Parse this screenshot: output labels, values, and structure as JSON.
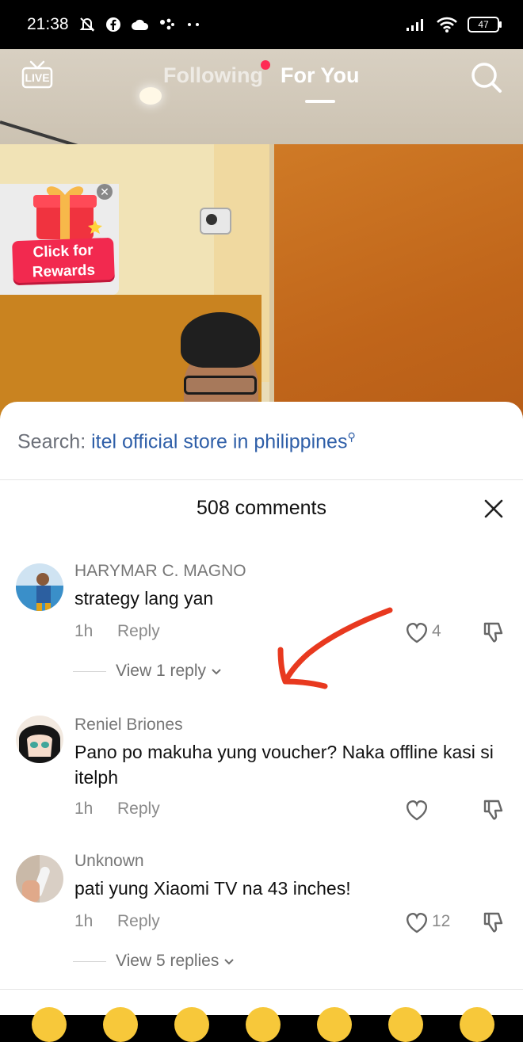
{
  "status_bar": {
    "time": "21:38",
    "battery": "47",
    "icons": [
      "mute-bell-icon",
      "facebook-icon",
      "cloud-icon",
      "assistant-dots-icon",
      "more-dots-icon",
      "signal-icon",
      "wifi-icon",
      "battery-icon"
    ]
  },
  "top_nav": {
    "live_label": "LIVE",
    "tabs": [
      {
        "label": "Following",
        "active": false,
        "has_dot": true
      },
      {
        "label": "For You",
        "active": true
      }
    ]
  },
  "rewards": {
    "label_line1": "Click for",
    "label_line2": "Rewards"
  },
  "sheet": {
    "search_prefix": "Search:",
    "search_term": "itel official store in philippines",
    "comment_count": "508 comments",
    "comments": [
      {
        "user": "HARYMAR C. MAGNO",
        "text": "strategy lang yan",
        "time": "1h",
        "reply_label": "Reply",
        "likes": "4",
        "view_replies": "View 1 reply"
      },
      {
        "user": "Reniel Briones",
        "text": "Pano po makuha yung voucher? Naka offline kasi si itelph",
        "time": "1h",
        "reply_label": "Reply",
        "likes": "",
        "view_replies": ""
      },
      {
        "user": "Unknown",
        "text": "pati yung Xiaomi TV na 43 inches!",
        "time": "1h",
        "reply_label": "Reply",
        "likes": "12",
        "view_replies": "View 5 replies"
      }
    ]
  },
  "colors": {
    "accent": "#fe2c55",
    "search_link": "#2f5fa8",
    "annotation_arrow": "#e8391f"
  }
}
